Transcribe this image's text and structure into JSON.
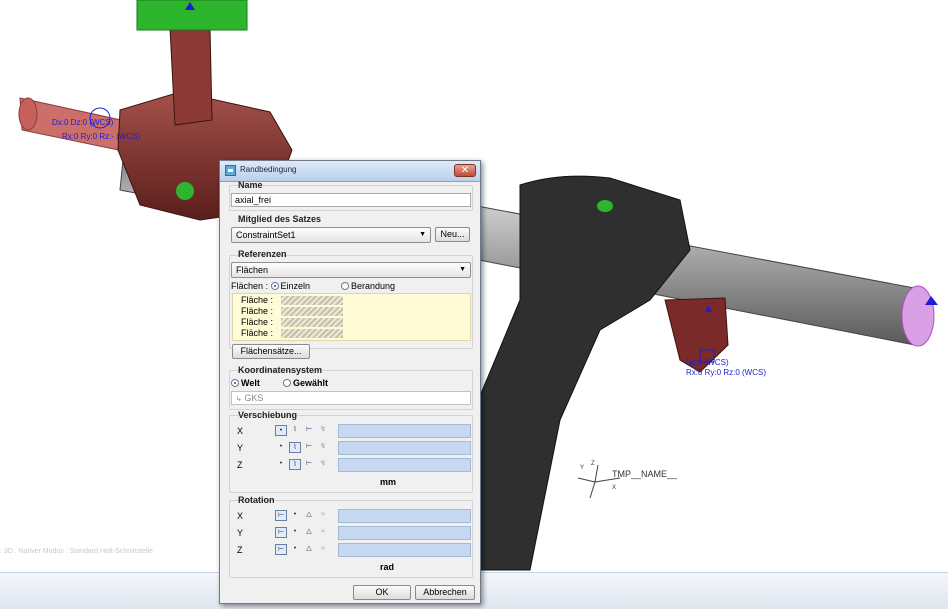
{
  "scene": {
    "labels": [
      "Dz:0 (WCS)",
      "Rx:0 Ry:0 Rz:- (WCS)",
      "Dx:0 Dz:0 (WCS)",
      "Rx:0 Ry:0 Rz:0 (WCS)",
      "TMP__NAME__",
      "X",
      "Y",
      "Z"
    ],
    "status_line": ": 3D : Nativer Modus : Standard Haft-Schnittstelle"
  },
  "dialog": {
    "title": "Randbedingung",
    "close_label": "✕",
    "name_section": "Name",
    "name_value": "axial_frei",
    "member_section": "Mitglied des Satzes",
    "constraint_set": "ConstraintSet1",
    "new_button": "Neu...",
    "references_section": "Referenzen",
    "references_type": "Flächen",
    "surfaces_label": "Flächen :",
    "radio_single": "Einzeln",
    "radio_boundary": "Berandung",
    "surface_items": [
      "Fläche :",
      "Fläche :",
      "Fläche :",
      "Fläche :"
    ],
    "surface_sets_button": "Flächensätze...",
    "coordsys_section": "Koordinatensystem",
    "radio_world": "Welt",
    "radio_selected": "Gewählt",
    "coordsys_value": "GKS",
    "translation_section": "Verschiebung",
    "rotation_section": "Rotation",
    "axes": [
      "X",
      "Y",
      "Z"
    ],
    "translation_unit": "mm",
    "rotation_unit": "rad",
    "ok_button": "OK",
    "cancel_button": "Abbrechen"
  },
  "colors": {
    "part_gray": "#9a9a9a",
    "part_red": "#7d2f2a",
    "arm_dark": "#303030",
    "constraint_blue": "#1d1dd8",
    "green_marker": "#2db52d",
    "field_blue": "#c6d8f2"
  }
}
